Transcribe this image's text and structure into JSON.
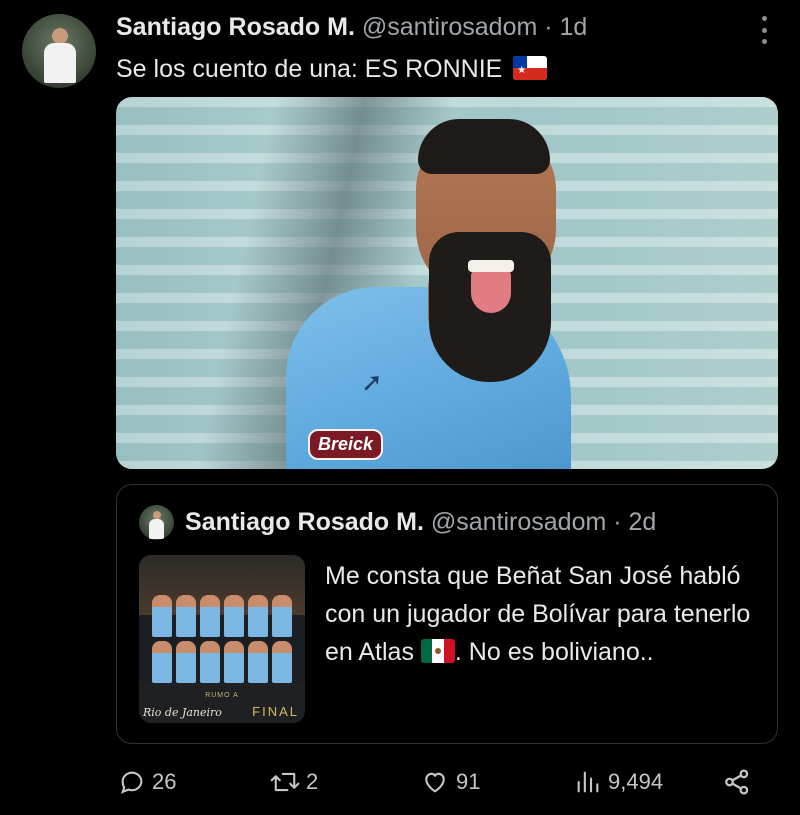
{
  "tweet": {
    "author_name": "Santiago Rosado M.",
    "handle_time": "@santirosadom · 1d",
    "text": "Se los cuento de una: ES RONNIE",
    "flag": "chile-flag"
  },
  "image": {
    "sponsor_logo": "Breick"
  },
  "quoted_tweet": {
    "author_name": "Santiago Rosado M.",
    "handle_time": "@santirosadom · 2d",
    "text_before_flag": "Me consta que Beñat San José habló con un jugador de Bolívar para tenerlo en Atlas",
    "text_after_flag": ". No es boliviano..",
    "flag": "mexico-flag",
    "thumbnail": {
      "rumo": "RUMO A",
      "script": "Rio de Janeiro",
      "final": "FINAL"
    }
  },
  "actions": {
    "replies": "26",
    "retweets": "2",
    "likes": "91",
    "views": "9,494"
  },
  "colors": {
    "background": "#000000",
    "text": "#e7e9ea",
    "secondary": "#a1a6ab",
    "border": "#2f3336"
  }
}
